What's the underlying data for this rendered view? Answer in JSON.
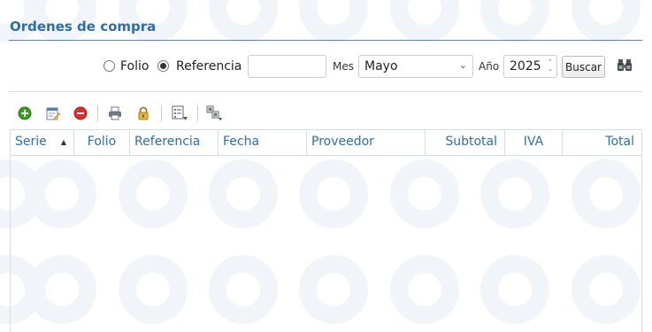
{
  "header": {
    "title": "Ordenes de compra"
  },
  "search": {
    "radio_folio_label": "Folio",
    "radio_referencia_label": "Referencia",
    "referencia_value": "",
    "mes_label": "Mes",
    "mes_value": "Mayo",
    "anio_label": "Año",
    "anio_value": "2025",
    "buscar_label": "Buscar"
  },
  "toolbar": {
    "icons": [
      "add-icon",
      "edit-icon",
      "delete-icon",
      "print-icon",
      "lock-icon",
      "list-export-icon",
      "transfer-icon"
    ]
  },
  "grid": {
    "columns": [
      "Serie",
      "Folio",
      "Referencia",
      "Fecha",
      "Proveedor",
      "Subtotal",
      "IVA",
      "Total"
    ],
    "rows": []
  },
  "colors": {
    "accent": "#2f6ea5",
    "add": "#3a9d23",
    "delete": "#d9302c"
  }
}
